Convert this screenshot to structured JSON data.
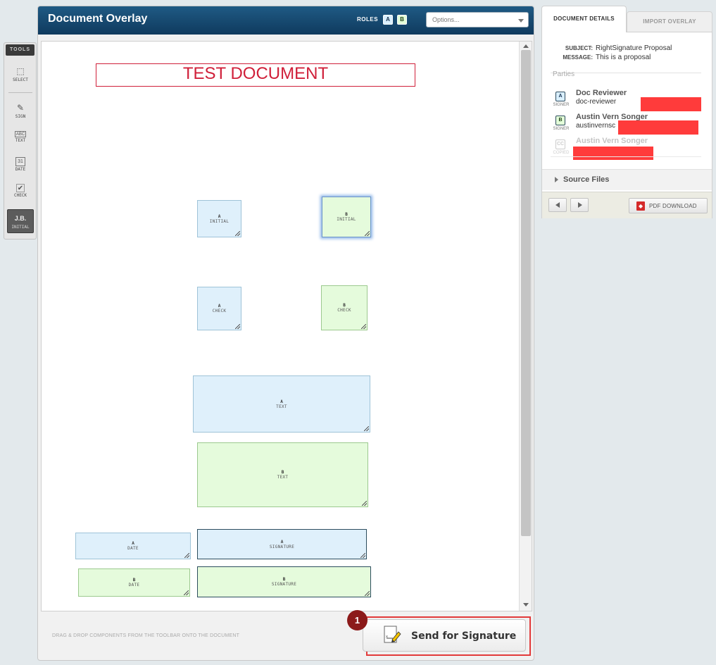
{
  "tools": {
    "header": "TOOLS",
    "items": [
      {
        "name": "select",
        "label": "SELECT",
        "icon": "⬚"
      },
      {
        "name": "sign",
        "label": "SIGN",
        "icon": "✎"
      },
      {
        "name": "text",
        "label": "TEXT",
        "icon": "ABC"
      },
      {
        "name": "date",
        "label": "DATE",
        "icon": "31"
      },
      {
        "name": "check",
        "label": "CHECK",
        "icon": "✔"
      },
      {
        "name": "initial",
        "label": "INITIAL",
        "icon": "J.B."
      }
    ]
  },
  "header": {
    "title": "Document Overlay",
    "roles_label": "ROLES",
    "role_a": "A",
    "role_b": "B",
    "options_placeholder": "Options..."
  },
  "document": {
    "title": "TEST DOCUMENT",
    "fields": [
      {
        "role": "A",
        "type": "INITIAL"
      },
      {
        "role": "B",
        "type": "INITIAL"
      },
      {
        "role": "A",
        "type": "CHECK"
      },
      {
        "role": "B",
        "type": "CHECK"
      },
      {
        "role": "A",
        "type": "TEXT"
      },
      {
        "role": "B",
        "type": "TEXT"
      },
      {
        "role": "A",
        "type": "DATE"
      },
      {
        "role": "A",
        "type": "SIGNATURE"
      },
      {
        "role": "B",
        "type": "DATE"
      },
      {
        "role": "B",
        "type": "SIGNATURE"
      }
    ]
  },
  "footer": {
    "hint": "DRAG & DROP COMPONENTS FROM THE TOOLBAR ONTO THE DOCUMENT",
    "send_label": "Send for Signature",
    "step_number": "1"
  },
  "side": {
    "tab_details": "DOCUMENT DETAILS",
    "tab_import": "IMPORT OVERLAY",
    "subject_key": "SUBJECT:",
    "subject_value": "RightSignature Proposal",
    "message_key": "MESSAGE:",
    "message_value": "This is a proposal",
    "parties_label": "Parties",
    "parties": [
      {
        "badge": "A",
        "role": "SIGNER",
        "name": "Doc Reviewer",
        "email": "doc-reviewer"
      },
      {
        "badge": "B",
        "role": "SIGNER",
        "name": "Austin Vern Songer",
        "email": "austinvernsc"
      },
      {
        "badge": "CC",
        "role": "COPIED",
        "name": "Austin Vern Songer",
        "email": ""
      }
    ],
    "source_files": "Source Files",
    "pdf_download": "PDF DOWNLOAD"
  },
  "colors": {
    "header_bg": "#15476d",
    "role_a_fill": "#dff0fb",
    "role_b_fill": "#e5fbdc",
    "title_red": "#d0203a",
    "highlight_red": "#e23a3a",
    "redaction": "#ff3b3b"
  }
}
